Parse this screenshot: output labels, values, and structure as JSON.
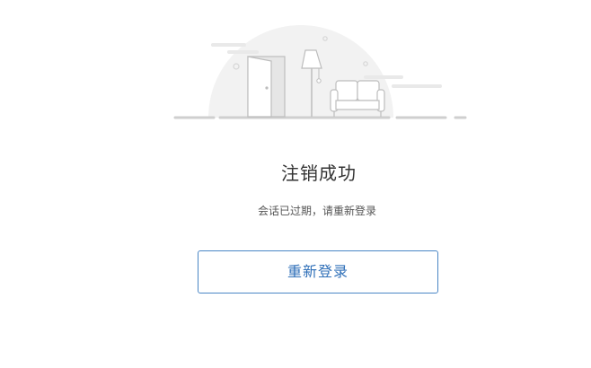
{
  "result": {
    "title": "注销成功",
    "message": "会话已过期，请重新登录",
    "relogin_label": "重新登录"
  },
  "colors": {
    "button_border": "#4a86c5",
    "button_text": "#2f6fb8",
    "title_text": "#333333",
    "illustration_bg": "#f2f2f2"
  },
  "illustration": {
    "icon": "empty-room-illustration"
  }
}
